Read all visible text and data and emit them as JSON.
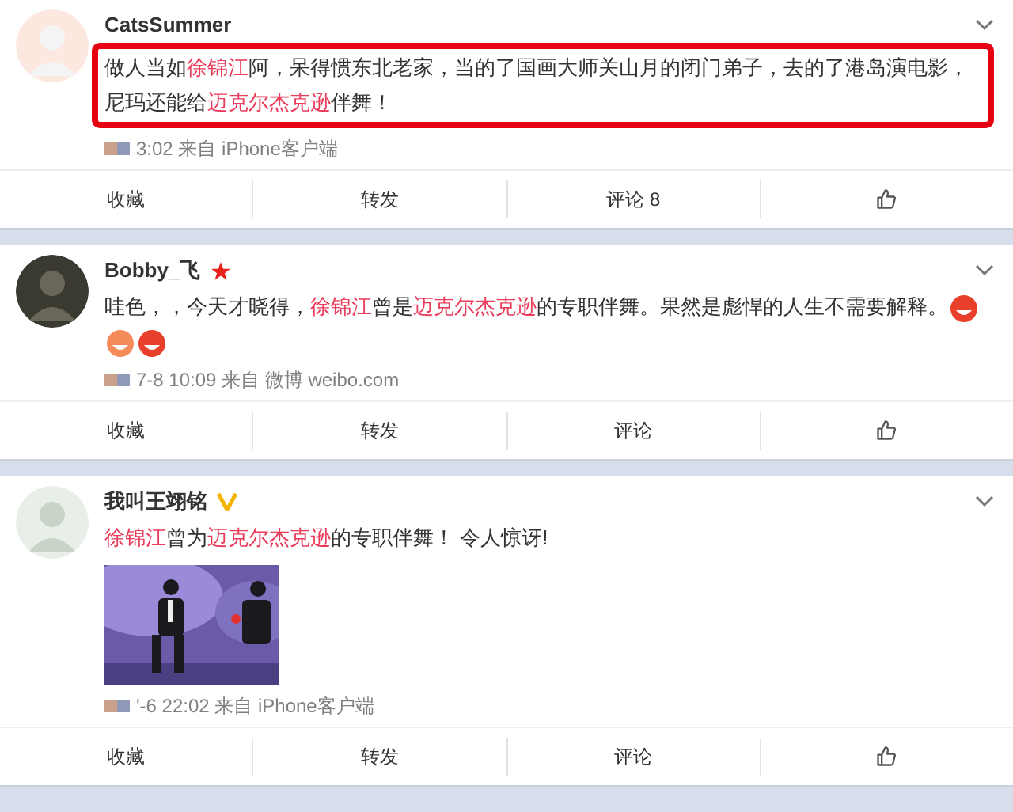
{
  "posts": [
    {
      "author": "CatsSummer",
      "star": false,
      "verified": false,
      "highlighted": true,
      "text": [
        {
          "kind": "plain",
          "text": "做人当如"
        },
        {
          "kind": "link",
          "text": "徐锦江"
        },
        {
          "kind": "plain",
          "text": "阿，呆得惯东北老家，当的了国画大师关山月的闭门弟子，去的了港岛演电影，尼玛还能给"
        },
        {
          "kind": "link",
          "text": "迈克尔杰克逊"
        },
        {
          "kind": "plain",
          "text": "伴舞！"
        }
      ],
      "meta": "3:02 来自 iPhone客户端",
      "actions": [
        "收藏",
        "转发",
        "评论 8"
      ]
    },
    {
      "author": "Bobby_飞",
      "star": true,
      "verified": false,
      "highlighted": false,
      "text": [
        {
          "kind": "plain",
          "text": "哇色，，今天才晓得，"
        },
        {
          "kind": "link",
          "text": "徐锦江"
        },
        {
          "kind": "plain",
          "text": "曾是"
        },
        {
          "kind": "link",
          "text": "迈克尔杰克逊"
        },
        {
          "kind": "plain",
          "text": "的专职伴舞。果然是彪悍的人生不需要解释。"
        },
        {
          "kind": "emoji"
        },
        {
          "kind": "emoji"
        },
        {
          "kind": "emoji"
        }
      ],
      "meta": "7-8 10:09 来自 微博 weibo.com",
      "actions": [
        "收藏",
        "转发",
        "评论"
      ]
    },
    {
      "author": "我叫王翊铭",
      "star": false,
      "verified": true,
      "highlighted": false,
      "text": [
        {
          "kind": "link",
          "text": "徐锦江"
        },
        {
          "kind": "plain",
          "text": "曾为"
        },
        {
          "kind": "link",
          "text": "迈克尔杰克逊"
        },
        {
          "kind": "plain",
          "text": "的专职伴舞！ 令人惊讶!"
        }
      ],
      "media": [
        {
          "kind": "picture"
        }
      ],
      "meta": "'-6 22:02 来自 iPhone客户端",
      "actions": [
        "收藏",
        "转发",
        "评论"
      ]
    }
  ]
}
